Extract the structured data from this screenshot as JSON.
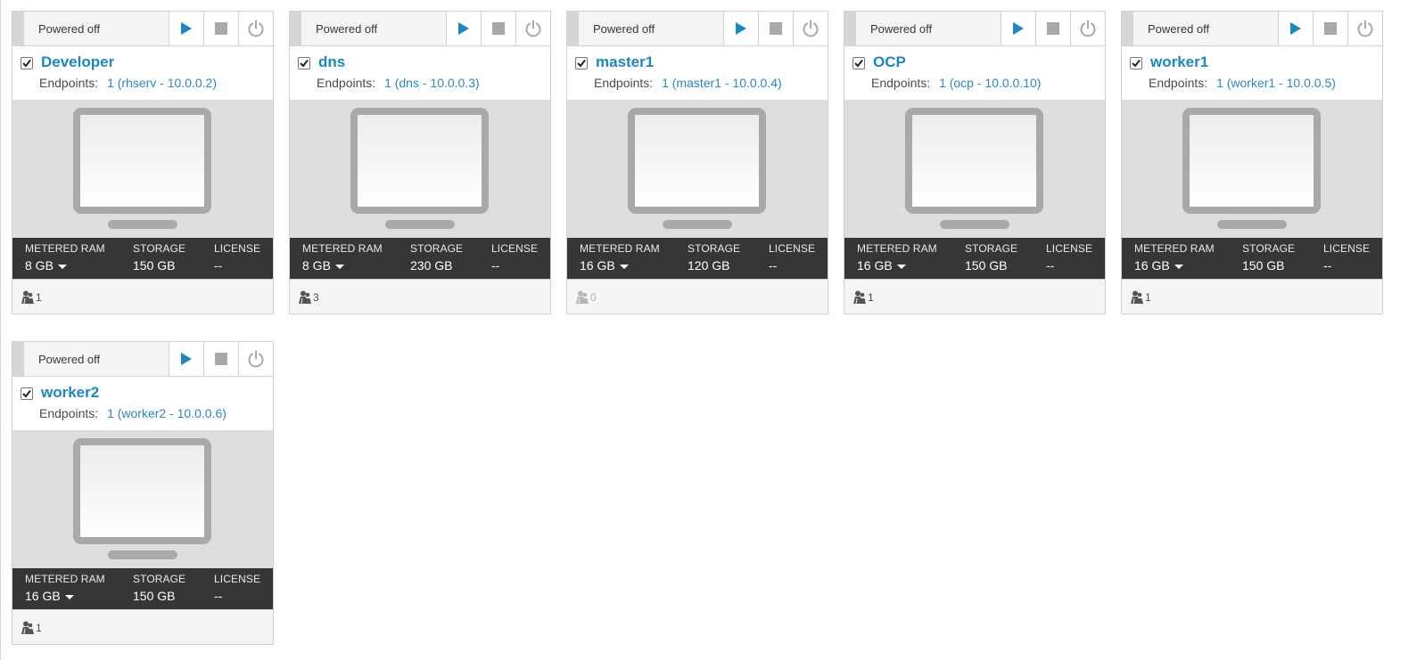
{
  "colors": {
    "accent": "#1b86c4",
    "play": "#1b86c4",
    "stop": "#a9a9a9",
    "power": "#a9a9a9",
    "stats_bg": "#363636"
  },
  "icons": {
    "play": "play-icon",
    "stop": "stop-icon",
    "power": "power-icon",
    "checkbox": "checkbox-checked-icon",
    "monitor": "monitor-icon",
    "users": "users-icon",
    "caret": "caret-down-icon"
  },
  "labels": {
    "endpoints": "Endpoints:",
    "metered_ram": "METERED RAM",
    "storage": "STORAGE",
    "license": "LICENSE"
  },
  "vms": [
    {
      "status": "Powered off",
      "checked": true,
      "name": "Developer",
      "endpoints": "1 (rhserv - 10.0.0.2)",
      "ram": "8 GB",
      "storage": "150 GB",
      "license": "--",
      "users": "1"
    },
    {
      "status": "Powered off",
      "checked": true,
      "name": "dns",
      "endpoints": "1 (dns - 10.0.0.3)",
      "ram": "8 GB",
      "storage": "230 GB",
      "license": "--",
      "users": "3"
    },
    {
      "status": "Powered off",
      "checked": true,
      "name": "master1",
      "endpoints": "1 (master1 - 10.0.0.4)",
      "ram": "16 GB",
      "storage": "120 GB",
      "license": "--",
      "users": "0"
    },
    {
      "status": "Powered off",
      "checked": true,
      "name": "OCP",
      "endpoints": "1 (ocp - 10.0.0.10)",
      "ram": "16 GB",
      "storage": "150 GB",
      "license": "--",
      "users": "1"
    },
    {
      "status": "Powered off",
      "checked": true,
      "name": "worker1",
      "endpoints": "1 (worker1 - 10.0.0.5)",
      "ram": "16 GB",
      "storage": "150 GB",
      "license": "--",
      "users": "1"
    },
    {
      "status": "Powered off",
      "checked": true,
      "name": "worker2",
      "endpoints": "1 (worker2 - 10.0.0.6)",
      "ram": "16 GB",
      "storage": "150 GB",
      "license": "--",
      "users": "1"
    }
  ]
}
